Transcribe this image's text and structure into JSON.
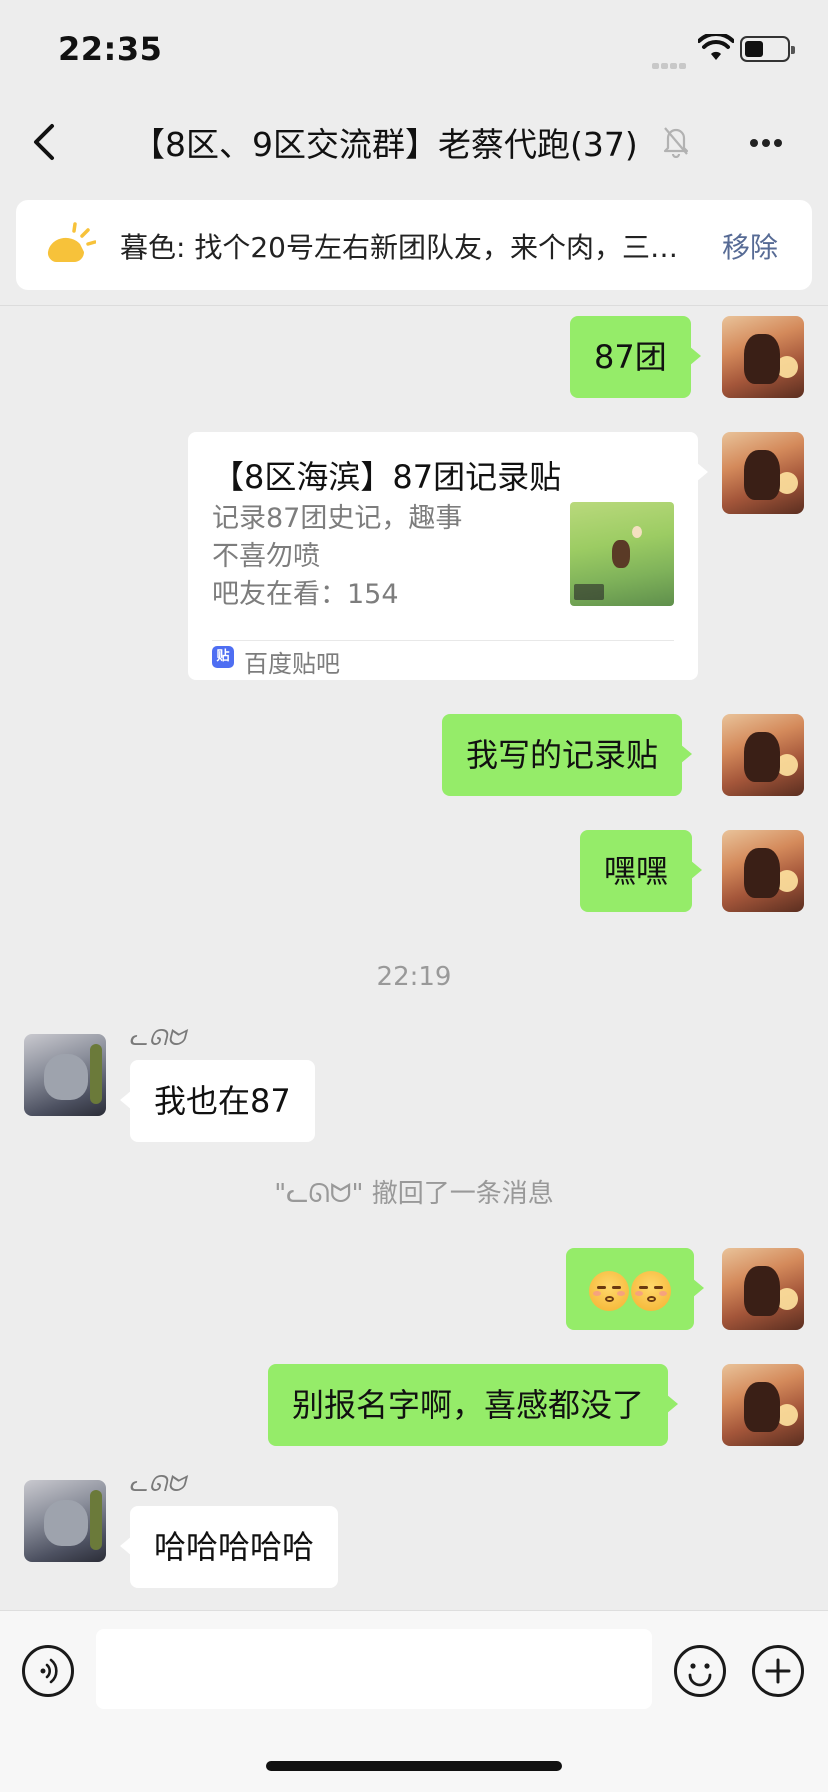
{
  "status_bar": {
    "time": "22:35"
  },
  "header": {
    "title": "【8区、9区交流群】老蔡代跑(37)",
    "back_icon": "chevron-left-icon",
    "mute_icon": "bell-slash-icon",
    "more_icon": "ellipsis-icon"
  },
  "notice": {
    "icon": "sun-announcement-icon",
    "text": "暮色: 找个20号左右新团队友，来个肉，三…",
    "remove_label": "移除"
  },
  "messages": {
    "m1": {
      "text": "87团"
    },
    "card": {
      "title": "【8区海滨】87团记录贴",
      "desc_line1": "记录87团史记，趣事",
      "desc_line2": "不喜勿喷",
      "desc_line3": "吧友在看：154",
      "source_icon_char": "贴",
      "source": "百度贴吧"
    },
    "m3": {
      "text": "我写的记录贴"
    },
    "m4": {
      "text": "嘿嘿"
    },
    "timestamp": "22:19",
    "m5": {
      "sender": "ᓚᘏᗢ",
      "text": "我也在87"
    },
    "recall": "\"ᓚᘏᗢ\" 撤回了一条消息",
    "m6": {
      "emoji": "smirk-face-emoji"
    },
    "m7": {
      "text": "别报名字啊，喜感都没了"
    },
    "m8": {
      "sender": "ᓚᘏᗢ",
      "text": "哈哈哈哈哈"
    }
  },
  "input_bar": {
    "voice_icon": "voice-icon",
    "emoji_icon": "smiley-icon",
    "plus_icon": "plus-icon",
    "value": ""
  }
}
